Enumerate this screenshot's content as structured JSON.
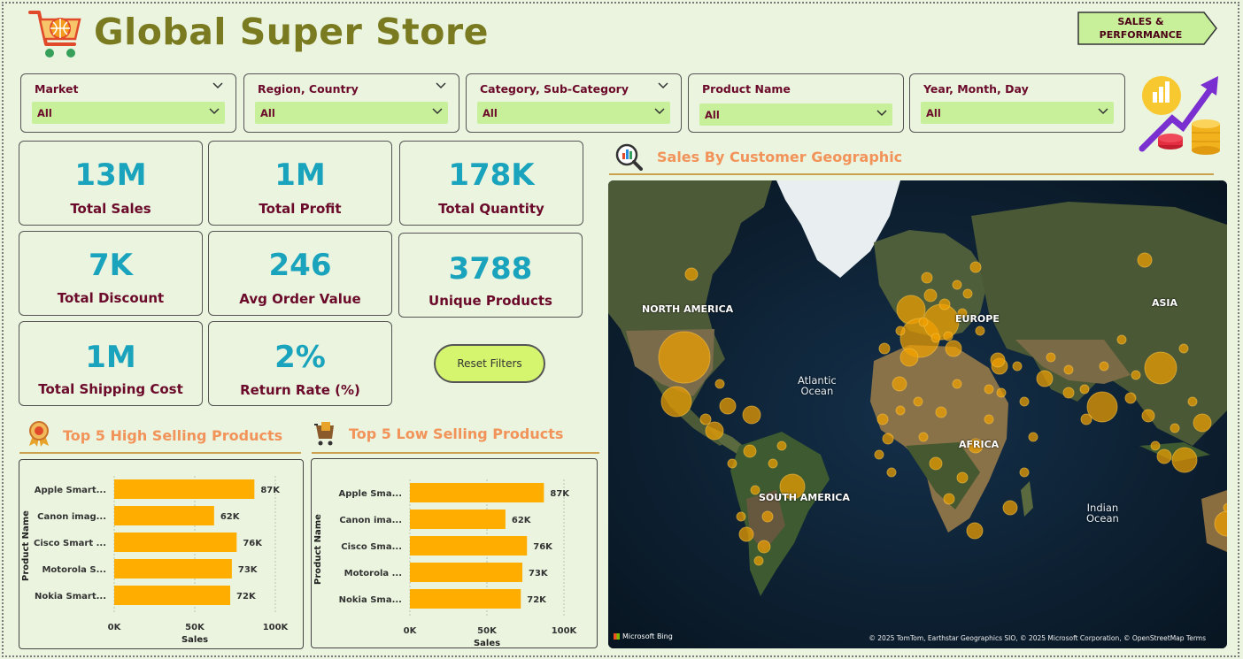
{
  "header": {
    "title": "Global Super Store",
    "nav_button": [
      "SALES &",
      "PERFORMANCE"
    ]
  },
  "slicers": [
    {
      "label": "Market",
      "value": "All"
    },
    {
      "label": "Region, Country",
      "value": "All"
    },
    {
      "label": "Category, Sub-Category",
      "value": "All"
    },
    {
      "label": "Product Name",
      "value": "All"
    },
    {
      "label": "Year, Month, Day",
      "value": "All"
    }
  ],
  "kpis": [
    {
      "value": "13M",
      "label": "Total Sales"
    },
    {
      "value": "1M",
      "label": "Total Profit"
    },
    {
      "value": "178K",
      "label": "Total Quantity"
    },
    {
      "value": "7K",
      "label": "Total Discount"
    },
    {
      "value": "246",
      "label": "Avg Order Value"
    },
    {
      "value": "3788",
      "label": "Unique Products"
    },
    {
      "value": "1M",
      "label": "Total Shipping Cost"
    },
    {
      "value": "2%",
      "label": "Return Rate (%)"
    }
  ],
  "reset_button": "Reset Filters",
  "map_section": {
    "title": "Sales By Customer Geographic",
    "labels": {
      "north_america": "NORTH AMERICA",
      "europe": "EUROPE",
      "asia": "ASIA",
      "africa": "AFRICA",
      "south_america": "SOUTH AMERICA",
      "atlantic": [
        "Atlantic",
        "Ocean"
      ],
      "indian": [
        "Indian",
        "Ocean"
      ]
    },
    "bing": "Microsoft Bing",
    "attribution": "© 2025 TomTom, Earthstar Geographics SIO, © 2025 Microsoft Corporation, © OpenStreetMap  Terms"
  },
  "colors": {
    "bar": "#ffae00",
    "kpi_value": "#1aa3bd",
    "kpi_label": "#6b0a2a",
    "section_title": "#f2935a"
  },
  "chart_data": [
    {
      "type": "bar",
      "orientation": "horizontal",
      "title": "Top 5 High Selling Products",
      "categories": [
        "Apple Smart...",
        "Canon imag...",
        "Cisco Smart ...",
        "Motorola S...",
        "Nokia Smart..."
      ],
      "values": [
        87000,
        62000,
        76000,
        73000,
        72000
      ],
      "data_labels": [
        "87K",
        "62K",
        "76K",
        "73K",
        "72K"
      ],
      "xlabel": "Sales",
      "ylabel": "Product Name",
      "xlim": [
        0,
        100000
      ],
      "x_ticks": [
        "0K",
        "50K",
        "100K"
      ]
    },
    {
      "type": "bar",
      "orientation": "horizontal",
      "title": "Top 5 Low Selling Products",
      "categories": [
        "Apple Sma...",
        "Canon ima...",
        "Cisco Sma...",
        "Motorola ...",
        "Nokia Sma..."
      ],
      "values": [
        87000,
        62000,
        76000,
        73000,
        72000
      ],
      "data_labels": [
        "87K",
        "62K",
        "76K",
        "73K",
        "72K"
      ],
      "xlabel": "Sales",
      "ylabel": "Product Name",
      "xlim": [
        0,
        100000
      ],
      "x_ticks": [
        "0K",
        "50K",
        "100K"
      ]
    }
  ]
}
